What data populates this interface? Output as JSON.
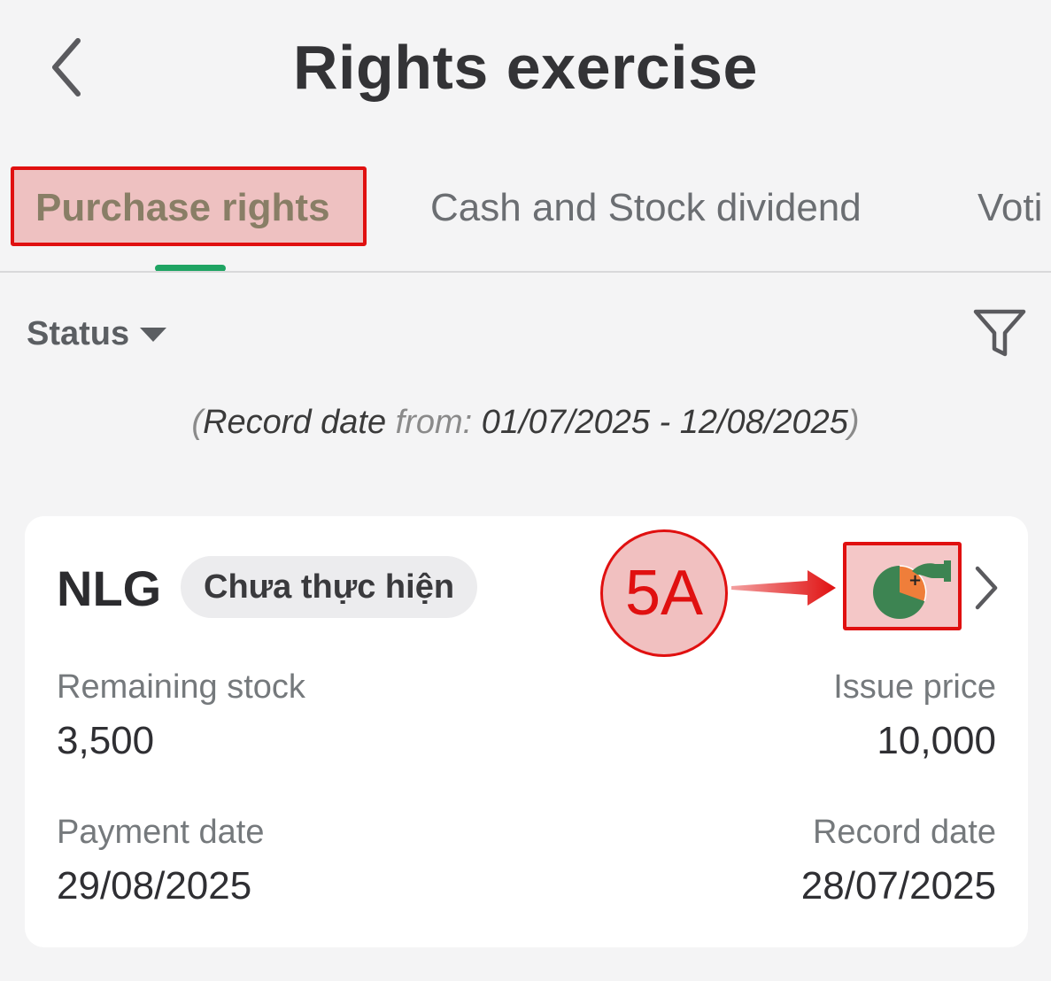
{
  "header": {
    "title": "Rights exercise"
  },
  "tabs": [
    {
      "label": "Purchase rights",
      "active": true
    },
    {
      "label": "Cash and Stock dividend",
      "active": false
    },
    {
      "label": "Voti",
      "active": false
    }
  ],
  "filter_bar": {
    "status_label": "Status"
  },
  "record_range": {
    "open_paren": "(",
    "label": "Record date",
    "from_label": "from:",
    "range": "01/07/2025 - 12/08/2025",
    "close_paren": ")"
  },
  "card": {
    "ticker": "NLG",
    "status": "Chưa thực hiện",
    "remaining_stock_label": "Remaining stock",
    "remaining_stock_value": "3,500",
    "issue_price_label": "Issue price",
    "issue_price_value": "10,000",
    "payment_date_label": "Payment date",
    "payment_date_value": "29/08/2025",
    "record_date_label": "Record date",
    "record_date_value": "28/07/2025"
  },
  "annotation": {
    "label": "5A",
    "color": "#e01010"
  },
  "colors": {
    "accent_green": "#1fa463",
    "active_tab_text": "#3c7a4f",
    "icon_green": "#3d8452",
    "icon_orange": "#ef7e3a"
  },
  "icons": [
    "back-chevron-icon",
    "filter-funnel-icon",
    "caret-down-icon",
    "rights-exercise-icon",
    "chevron-right-icon"
  ]
}
